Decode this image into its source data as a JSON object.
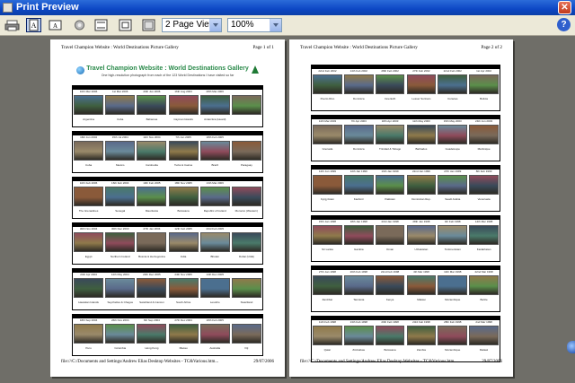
{
  "window": {
    "title": "Print Preview",
    "close_icon": "close-icon",
    "colors": {
      "titlebar": "#0d47c4",
      "close": "#c23a1c"
    }
  },
  "toolbar": {
    "view_select": "2 Page View",
    "zoom_select": "100%",
    "icons": [
      "print-icon",
      "portrait-icon",
      "landscape-icon",
      "page-setup-icon",
      "header-footer-icon",
      "full-screen-icon",
      "help-icon"
    ]
  },
  "page1": {
    "header_left": "Travel Champion Website : World Destinations Picture Gallery",
    "header_right": "Page 1 of 1",
    "site_title": "Travel Champion Website : World Destinations Gallery",
    "site_subtitle": "One high-resolution photograph from each of the 123 World Destinations I have visited so far",
    "footer_left": "file:///C:/Documents and Settings/Andrew Elias Desktop Websites - TC&Various.htm...",
    "footer_right": "29/07/2006",
    "rows": [
      {
        "dates": [
          "10th Mar 2006",
          "1st Mar 2006",
          "20th Jun 2006",
          "16th Aug 2003",
          "28th Mar 2006"
        ],
        "captions": [
          "Argentina",
          "Cuba",
          "Bahamas",
          "Cayman Islands",
          "Antarctica (Heard)"
        ]
      },
      {
        "dates": [
          "16th Jun 2004",
          "15th Jul 2004",
          "11th Nov 2004",
          "7th Jun 2005",
          "18th Feb 2005"
        ],
        "captions": [
          "Cuba",
          "Mexico",
          "Cambodia",
          "Turks & Caicos",
          "Brazil",
          "Paraguay"
        ]
      },
      {
        "dates": [
          "10th Feb 2006",
          "16th Feb 2004",
          "10th Feb 2005",
          "18th Nov 2005",
          "13th Mar 2006"
        ],
        "captions": [
          "The Grenadines",
          "Senegal",
          "Mauritania",
          "Botswana",
          "Republic of Ireland",
          "Morocco (Western)"
        ]
      },
      {
        "dates": [
          "30th Nov 2004",
          "30th Dec 2003",
          "27th Jan 2004",
          "12th Feb 2005",
          "23rd Feb 2005"
        ],
        "captions": [
          "Egypt",
          "Northern Ireland",
          "Bosnia & Herzegovina",
          "India",
          "Bhutan",
          "Dubai (UAE)"
        ]
      },
      {
        "dates": [
          "24th Apr 2004",
          "12th May 2004",
          "20th Dec 2005",
          "24th Nov 2005",
          "14th Dec 2005"
        ],
        "captions": [
          "Hawaiian Islands",
          "Seychelles & Chagos",
          "Swaziland & Cancun",
          "South Africa",
          "Lesotho",
          "Swaziland"
        ]
      },
      {
        "dates": [
          "18th Sep 2004",
          "26th Nov 2004",
          "6th Sep 2004",
          "27th Dec 2004",
          "18th Feb 2005"
        ],
        "captions": [
          "Peru",
          "Columbia",
          "Hong Kong",
          "Macau",
          "Australia",
          "Fiji"
        ]
      }
    ]
  },
  "page2": {
    "header_left": "Travel Champion Website : World Destinations Picture Gallery",
    "header_right": "Page 2 of 2",
    "footer_left": "file:///C:/Documents and Settings/Andrew Elias Desktop Websites - TC&Various.htm...",
    "footer_right": "29/07/2006",
    "rows": [
      {
        "dates": [
          "22nd Feb 2002",
          "14th Feb 2002",
          "28th Feb 2002",
          "27th Feb 2002",
          "22nd Feb 2002",
          "1st Apr 2002"
        ],
        "captions": [
          "Puerto Rico",
          "Dominica",
          "Innerleith",
          "Lesser Surinam",
          "Curacao",
          "Bolivia"
        ]
      },
      {
        "dates": [
          "14th Mar 2003",
          "7th Apr 2003",
          "18th Apr 2003",
          "11th May 2003",
          "15th May 2003",
          "24th Jun 2003"
        ],
        "captions": [
          "Grenada",
          "Dominica",
          "Trinidad & Tobago",
          "Barbados",
          "Guadeloupe",
          "Martinique"
        ]
      },
      {
        "dates": [
          "14th Jun 1999",
          "12th Jan 1999",
          "19th Jan 1999",
          "22nd Jan 1999",
          "27th Jan 1999",
          "8th Feb 1999"
        ],
        "captions": [
          "Kyrgyzstan",
          "Kashmir",
          "Pakistan",
          "Dominican Rep.",
          "Saudi Arabia",
          "Venezuela"
        ]
      },
      {
        "dates": [
          "15th Jan 1998",
          "18th Jan 1998",
          "23rd Jan 1998",
          "28th Jan 1998",
          "4th Feb 1998",
          "14th Mar 1998"
        ],
        "captions": [
          "Sri Lanka",
          "Gambia",
          "Oman",
          "Uzbekistan",
          "Turkmenistan",
          "Kazakhstan"
        ]
      },
      {
        "dates": [
          "27th Jan 1998",
          "20th Feb 1998",
          "22nd Feb 1998",
          "4th Mar 1998",
          "14th Mar 1998",
          "22nd Mar 1998"
        ],
        "captions": [
          "Zanzibar",
          "Tanzania",
          "Kenya",
          "Malawi",
          "Mozambique",
          "Belize"
        ]
      },
      {
        "dates": [
          "11th Feb 1998",
          "13th Feb 1998",
          "20th Feb 1998",
          "23rd Feb 1998",
          "28th Feb 1998",
          "2nd Mar 1998"
        ],
        "captions": [
          "Qatar",
          "Zimbabwe",
          "Botswana",
          "Zambia",
          "Mozambique",
          "Malawi"
        ]
      }
    ]
  }
}
